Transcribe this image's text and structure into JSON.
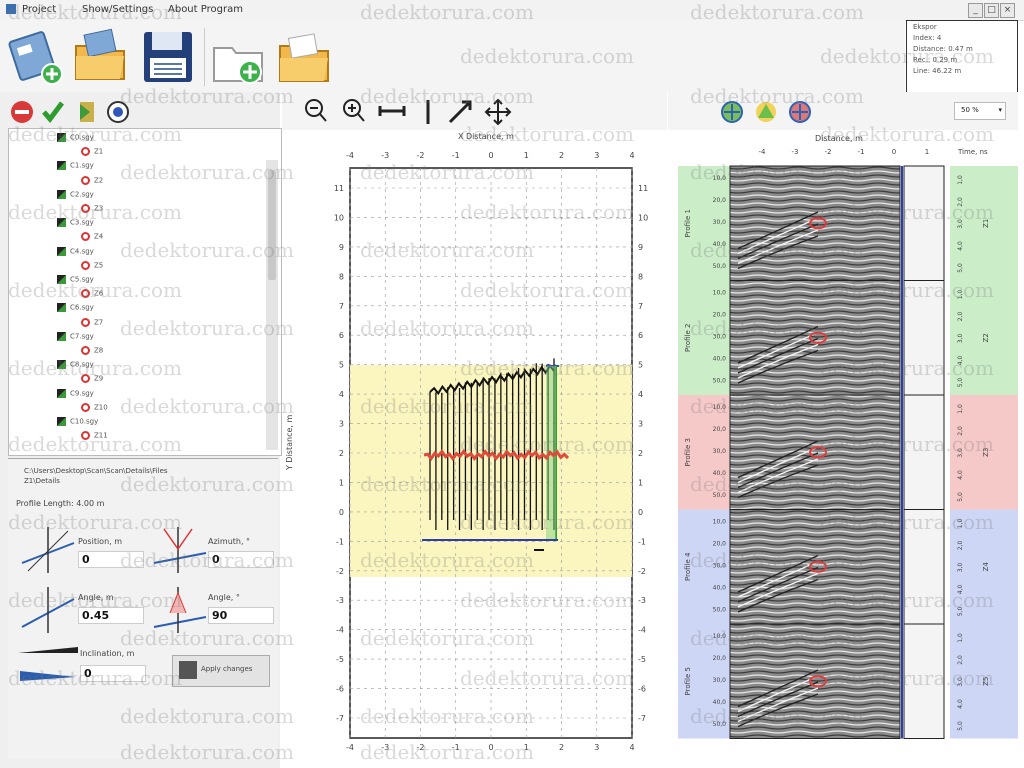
{
  "menu": {
    "items": [
      "Project",
      "Show/Settings",
      "About Program"
    ]
  },
  "window": {
    "min": "_",
    "max": "□",
    "close": "×"
  },
  "toolbar": {
    "icons": [
      "new-project-icon",
      "open-project-icon",
      "save-project-icon",
      "add-file-icon",
      "open-folder-icon"
    ]
  },
  "info_box": {
    "lines": [
      "Ekspor",
      "Index: 4",
      "Distance: 0.47 m",
      "Rec.: 0.29 m",
      "Line: 46.22 m"
    ]
  },
  "tree": {
    "rows": [
      {
        "indent": 56,
        "label": "C0.sgy"
      },
      {
        "indent": 80,
        "label": "Z1"
      },
      {
        "indent": 56,
        "label": "C1.sgy"
      },
      {
        "indent": 80,
        "label": "Z2"
      },
      {
        "indent": 56,
        "label": "C2.sgy"
      },
      {
        "indent": 80,
        "label": "Z3"
      },
      {
        "indent": 56,
        "label": "C3.sgy"
      },
      {
        "indent": 80,
        "label": "Z4"
      },
      {
        "indent": 56,
        "label": "C4.sgy"
      },
      {
        "indent": 80,
        "label": "Z5"
      },
      {
        "indent": 56,
        "label": "C5.sgy"
      },
      {
        "indent": 80,
        "label": "Z6"
      },
      {
        "indent": 56,
        "label": "C6.sgy"
      },
      {
        "indent": 80,
        "label": "Z7"
      },
      {
        "indent": 56,
        "label": "C7.sgy"
      },
      {
        "indent": 80,
        "label": "Z8"
      },
      {
        "indent": 56,
        "label": "C8.sgy"
      },
      {
        "indent": 80,
        "label": "Z9"
      },
      {
        "indent": 56,
        "label": "C9.sgy"
      },
      {
        "indent": 80,
        "label": "Z10"
      },
      {
        "indent": 56,
        "label": "C10.sgy"
      },
      {
        "indent": 80,
        "label": "Z11"
      }
    ]
  },
  "properties": {
    "path": "C:\\Users\\Desktop\\Scan\\Scan\\Details\\Files",
    "path2": "Z1\\Details",
    "profile_length": "Profile Length: 4.00 m",
    "position_label": "Position, m",
    "position_value": "0",
    "azimuth_label": "Azimuth, °",
    "azimuth_value": "0",
    "angle_x_label": "Angle, m",
    "angle_x_value": "0.45",
    "angle_y_label": "Angle, °",
    "angle_y_value": "90",
    "bottom_label": "Inclination, m",
    "bottom_value": "0",
    "apply_label": "Apply changes"
  },
  "mid_tools": [
    "zoom-out-icon",
    "zoom-in-icon",
    "horizontal-scale-icon",
    "vertical-scale-icon",
    "diagonal-arrow-icon",
    "move-icon"
  ],
  "right_tools": [
    "add-green-icon",
    "add-yellow-icon",
    "remove-red-icon"
  ],
  "right_dropdown": {
    "value": "50 %"
  },
  "plot": {
    "top_axis_title": "X Distance, m",
    "left_axis_title": "Y Distance, m",
    "top_ticks": [
      "-4",
      "-3",
      "-2",
      "-1",
      "0",
      "1",
      "2",
      "3",
      "4"
    ],
    "left_ticks": [
      "11",
      "10",
      "9",
      "8",
      "7",
      "6",
      "5",
      "4",
      "3",
      "2",
      "1",
      "0",
      "-1",
      "-2",
      "-3",
      "-4",
      "-5",
      "-6",
      "-7"
    ],
    "right_ticks": [
      "11",
      "10",
      "9",
      "8",
      "7",
      "6",
      "5",
      "4",
      "3",
      "2",
      "1",
      "0",
      "-1",
      "-2",
      "-3",
      "-4",
      "-5",
      "-6",
      "-7"
    ]
  },
  "radar": {
    "distance_label": "Distance, m",
    "dist_ticks": [
      "-4",
      "-3",
      "-2",
      "-1",
      "0",
      "1"
    ],
    "time_header": "Time, ns",
    "depth_ticks": [
      "10,0",
      "20,0",
      "30,0",
      "40,0",
      "50,0"
    ],
    "panels": [
      {
        "label": "Profile 1",
        "color": "#cbeec9",
        "side": "Z1"
      },
      {
        "label": "Profile 2",
        "color": "#cbeec9",
        "side": "Z2"
      },
      {
        "label": "Profile 3",
        "color": "#f6c9c9",
        "side": "Z3"
      },
      {
        "label": "Profile 4",
        "color": "#cdd6f5",
        "side": "Z4"
      },
      {
        "label": "Profile 5",
        "color": "#cdd6f5",
        "side": "Z5"
      }
    ],
    "right_ticks": [
      "1,0",
      "2,0",
      "3,0",
      "4,0",
      "5,0"
    ]
  },
  "watermark": "dedektorura.com"
}
